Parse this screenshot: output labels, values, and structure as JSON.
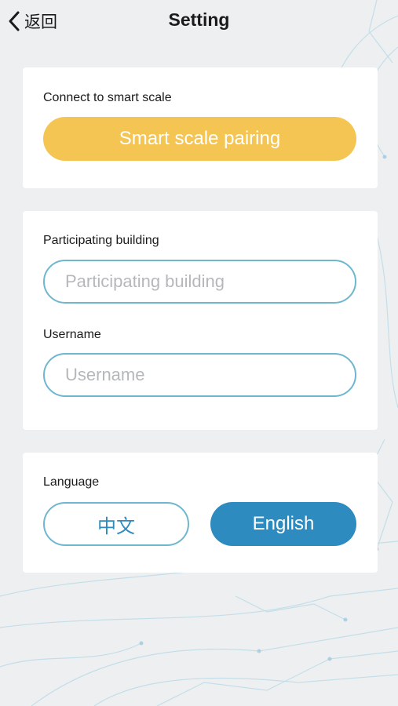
{
  "nav": {
    "back_label": "返回",
    "title": "Setting"
  },
  "scale": {
    "label": "Connect to smart scale",
    "button_label": "Smart scale pairing"
  },
  "profile": {
    "building": {
      "label": "Participating building",
      "placeholder": "Participating building",
      "value": ""
    },
    "username": {
      "label": "Username",
      "placeholder": "Username",
      "value": ""
    }
  },
  "language": {
    "label": "Language",
    "options": [
      "中文",
      "English"
    ],
    "selected": "English"
  },
  "colors": {
    "accent_yellow": "#f4c553",
    "accent_blue": "#2e8bbf",
    "field_border": "#6fb6d0",
    "background": "#eeeff0"
  },
  "icons": {
    "back": "chevron-left-icon"
  }
}
